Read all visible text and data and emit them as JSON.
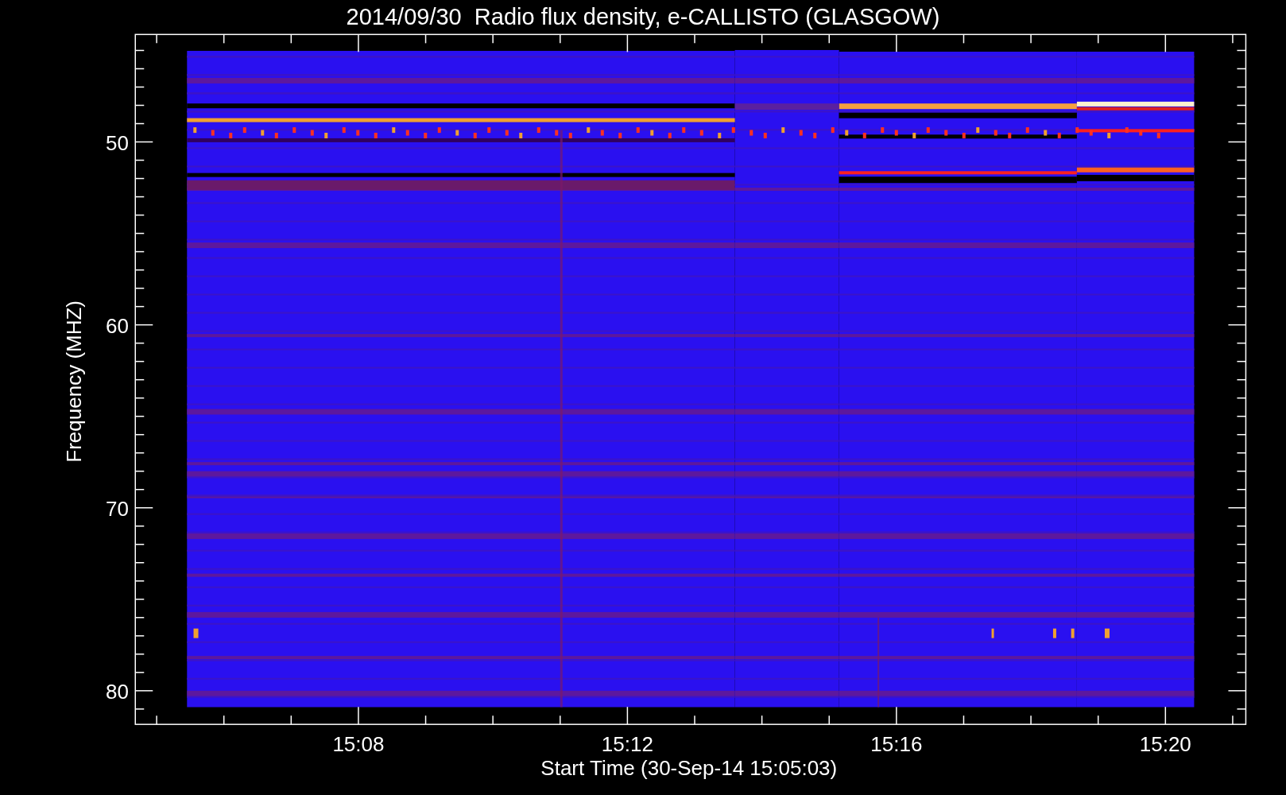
{
  "plot": {
    "title": "2014/09/30  Radio flux density, e-CALLISTO (GLASGOW)",
    "y_axis": {
      "label": "Frequency (MHZ)",
      "ticks": [
        "50",
        "60",
        "70",
        "80"
      ]
    },
    "x_axis": {
      "label": "Start Time (30-Sep-14 15:05:03)",
      "ticks": [
        "15:08",
        "15:12",
        "15:16",
        "15:20"
      ]
    }
  }
}
